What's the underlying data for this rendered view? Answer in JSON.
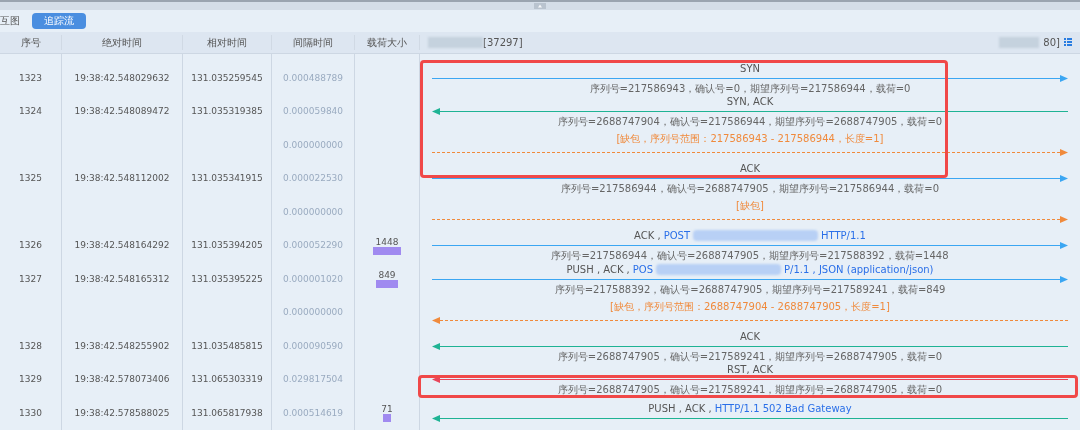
{
  "toolbar": {
    "view_label": "互图",
    "buttons": [
      {
        "label": "追踪流",
        "selected": true
      }
    ]
  },
  "columns": [
    "序号",
    "绝对时间",
    "相对时间",
    "间隔时间",
    "载荷大小"
  ],
  "endpoints": {
    "left": "[37297]",
    "right": "80]"
  },
  "rows": [
    {
      "kind": "packet",
      "no": "1323",
      "abs": "19:38:42.548029632",
      "rel": "131.035259545",
      "interval": "0.000488789",
      "to_left": false,
      "color": "#3ba6f2",
      "label": [
        {
          "kind": "plain",
          "text": "SYN"
        }
      ],
      "detail": "序列号=217586943，确认号=0，期望序列号=217586944，载荷=0"
    },
    {
      "kind": "packet",
      "no": "1324",
      "abs": "19:38:42.548089472",
      "rel": "131.035319385",
      "interval": "0.000059840",
      "to_left": true,
      "color": "#1fb394",
      "label": [
        {
          "kind": "plain",
          "text": "SYN, ACK"
        }
      ],
      "detail": "序列号=2688747904，确认号=217586944，期望序列号=2688747905，载荷=0"
    },
    {
      "kind": "gap",
      "interval": "0.000000000",
      "to_left": false,
      "label": "[缺包，序列号范围：217586943 - 217586944，长度=1]"
    },
    {
      "kind": "packet",
      "no": "1325",
      "abs": "19:38:42.548112002",
      "rel": "131.035341915",
      "interval": "0.000022530",
      "to_left": false,
      "color": "#3ba6f2",
      "label": [
        {
          "kind": "plain",
          "text": "ACK"
        }
      ],
      "detail": "序列号=217586944，确认号=2688747905，期望序列号=217586944，载荷=0"
    },
    {
      "kind": "gap",
      "interval": "0.000000000",
      "to_left": false,
      "label": "[缺包]"
    },
    {
      "kind": "packet",
      "no": "1326",
      "abs": "19:38:42.548164292",
      "rel": "131.035394205",
      "interval": "0.000052290",
      "payload": "1448",
      "to_left": false,
      "color": "#3ba6f2",
      "label": [
        {
          "kind": "plain",
          "text": "ACK ,"
        },
        {
          "kind": "link",
          "text": "POST"
        },
        {
          "kind": "redacted"
        },
        {
          "kind": "link",
          "text": "HTTP/1.1"
        }
      ],
      "detail": "序列号=217586944，确认号=2688747905，期望序列号=217588392，载荷=1448"
    },
    {
      "kind": "packet",
      "no": "1327",
      "abs": "19:38:42.548165312",
      "rel": "131.035395225",
      "interval": "0.000001020",
      "payload": "849",
      "to_left": false,
      "color": "#3ba6f2",
      "label": [
        {
          "kind": "plain",
          "text": "PUSH , ACK ,"
        },
        {
          "kind": "link",
          "text": "POS"
        },
        {
          "kind": "redacted"
        },
        {
          "kind": "link",
          "text": "P/1.1 , JSON (application/json)"
        }
      ],
      "detail": "序列号=217588392，确认号=2688747905，期望序列号=217589241，载荷=849"
    },
    {
      "kind": "gap",
      "interval": "0.000000000",
      "to_left": true,
      "label": "[缺包，序列号范围：2688747904 - 2688747905，长度=1]"
    },
    {
      "kind": "packet",
      "no": "1328",
      "abs": "19:38:42.548255902",
      "rel": "131.035485815",
      "interval": "0.000090590",
      "to_left": true,
      "color": "#1fb394",
      "label": [
        {
          "kind": "plain",
          "text": "ACK"
        }
      ],
      "detail": "序列号=2688747905，确认号=217589241，期望序列号=2688747905，载荷=0"
    },
    {
      "kind": "packet",
      "no": "1329",
      "abs": "19:38:42.578073406",
      "rel": "131.065303319",
      "interval": "0.029817504",
      "to_left": true,
      "color": "#e8455a",
      "label": [
        {
          "kind": "plain",
          "text": "RST, ACK"
        }
      ],
      "detail": "序列号=2688747905，确认号=217589241，期望序列号=2688747905，载荷=0"
    },
    {
      "kind": "packet",
      "no": "1330",
      "abs": "19:38:42.578588025",
      "rel": "131.065817938",
      "interval": "0.000514619",
      "payload": "71",
      "to_left": true,
      "color": "#1fb394",
      "label": [
        {
          "kind": "plain",
          "text": "PUSH , ACK ,"
        },
        {
          "kind": "link",
          "text": "HTTP/1.1 502 Bad Gateway"
        }
      ]
    }
  ]
}
